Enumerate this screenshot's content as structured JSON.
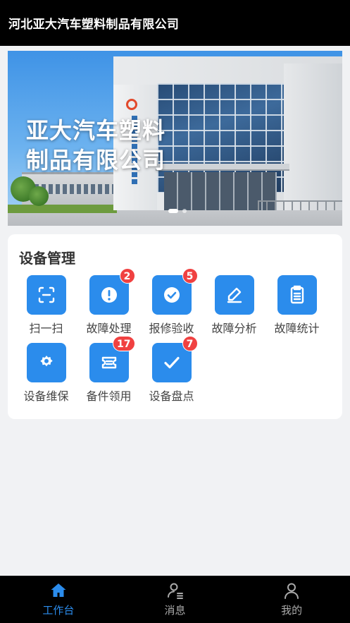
{
  "header": {
    "title": "河北亚大汽车塑料制品有限公司"
  },
  "banner": {
    "line1": "亚大汽车塑料",
    "line2": "制品有限公司",
    "slides": 2,
    "active_slide": 1
  },
  "card": {
    "title": "设备管理",
    "items": [
      {
        "label": "扫一扫",
        "icon": "scan-icon",
        "badge": ""
      },
      {
        "label": "故障处理",
        "icon": "alert-icon",
        "badge": "2"
      },
      {
        "label": "报修验收",
        "icon": "check-circle-icon",
        "badge": "5"
      },
      {
        "label": "故障分析",
        "icon": "pencil-icon",
        "badge": ""
      },
      {
        "label": "故障统计",
        "icon": "clipboard-icon",
        "badge": ""
      },
      {
        "label": "设备维保",
        "icon": "gear-icon",
        "badge": ""
      },
      {
        "label": "备件领用",
        "icon": "ticket-icon",
        "badge": "17"
      },
      {
        "label": "设备盘点",
        "icon": "checkmark-icon",
        "badge": "7"
      }
    ]
  },
  "tabbar": {
    "tabs": [
      {
        "label": "工作台",
        "icon": "home-icon",
        "active": true
      },
      {
        "label": "消息",
        "icon": "user-list-icon",
        "active": false
      },
      {
        "label": "我的",
        "icon": "user-icon",
        "active": false
      }
    ]
  },
  "colors": {
    "accent": "#2b8cec",
    "badge": "#f04141",
    "header_bg": "#000000",
    "page_bg": "#f1f2f4"
  }
}
